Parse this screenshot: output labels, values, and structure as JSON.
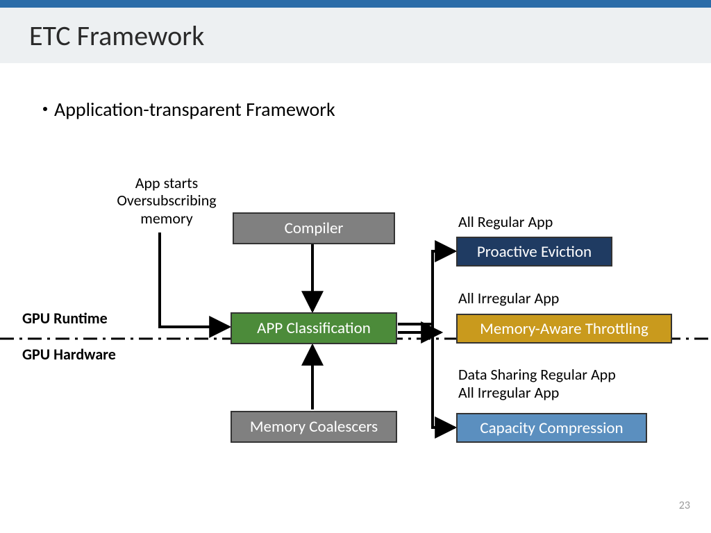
{
  "slide": {
    "title": "ETC Framework",
    "bullet": "Application-transparent Framework",
    "page_number": "23"
  },
  "labels": {
    "oversub": "App starts\nOversubscribing\nmemory",
    "gpu_runtime": "GPU Runtime",
    "gpu_hardware": "GPU Hardware",
    "all_regular": "All Regular App",
    "all_irregular": "All Irregular App",
    "data_sharing_line1": "Data Sharing Regular App",
    "data_sharing_line2": "All Irregular App"
  },
  "boxes": {
    "compiler": "Compiler",
    "app_classification": "APP Classification",
    "memory_coalescers": "Memory Coalescers",
    "proactive_eviction": "Proactive Eviction",
    "memory_aware_throttling": "Memory-Aware Throttling",
    "capacity_compression": "Capacity Compression"
  },
  "chart_data": {
    "type": "diagram",
    "title": "ETC Framework",
    "nodes": [
      {
        "id": "compiler",
        "label": "Compiler",
        "layer": "GPU Runtime"
      },
      {
        "id": "app_classification",
        "label": "APP Classification",
        "layer": "boundary"
      },
      {
        "id": "memory_coalescers",
        "label": "Memory Coalescers",
        "layer": "GPU Hardware"
      },
      {
        "id": "proactive_eviction",
        "label": "Proactive Eviction",
        "condition": "All Regular App"
      },
      {
        "id": "memory_aware_throttling",
        "label": "Memory-Aware Throttling",
        "condition": "All Irregular App"
      },
      {
        "id": "capacity_compression",
        "label": "Capacity Compression",
        "condition": "Data Sharing Regular App / All Irregular App"
      }
    ],
    "edges": [
      {
        "from": "oversubscribe_trigger",
        "to": "app_classification"
      },
      {
        "from": "compiler",
        "to": "app_classification"
      },
      {
        "from": "memory_coalescers",
        "to": "app_classification"
      },
      {
        "from": "app_classification",
        "to": "proactive_eviction"
      },
      {
        "from": "app_classification",
        "to": "memory_aware_throttling"
      },
      {
        "from": "app_classification",
        "to": "capacity_compression"
      }
    ],
    "layers": [
      "GPU Runtime",
      "GPU Hardware"
    ],
    "trigger_label": "App starts Oversubscribing memory"
  }
}
